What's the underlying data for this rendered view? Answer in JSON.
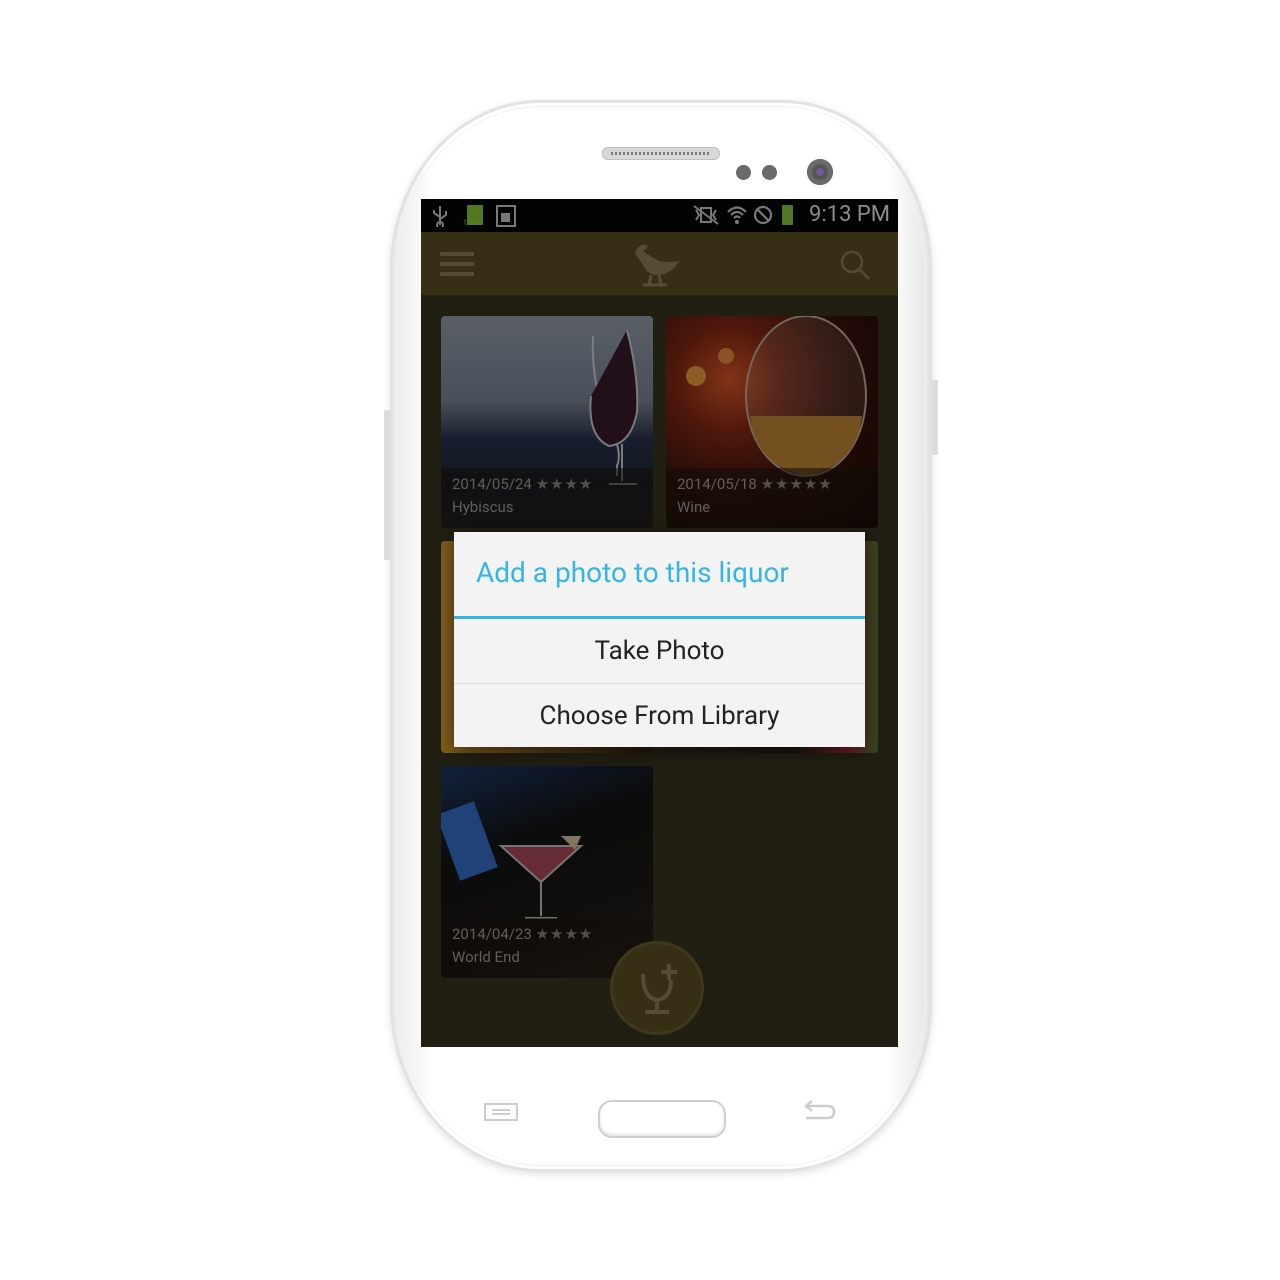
{
  "status_bar": {
    "time": "9:13 PM",
    "battery_label": "100%",
    "icons": [
      "usb-icon",
      "battery-full-icon",
      "sim-card-icon",
      "vibrate-icon",
      "wifi-icon",
      "block-icon",
      "battery-icon"
    ]
  },
  "app_bar": {
    "icons": [
      "menu-icon",
      "bird-logo-icon",
      "search-icon"
    ]
  },
  "cards": [
    {
      "date": "2014/05/24",
      "stars": "★★★★",
      "name": "Hybiscus"
    },
    {
      "date": "2014/05/18",
      "stars": "★★★★★",
      "name": "Wine"
    },
    {
      "date": "2014/04/23",
      "stars": "★★★★",
      "name": "World End"
    }
  ],
  "dialog": {
    "title": "Add a photo to this liquor",
    "options": [
      "Take Photo",
      "Choose From Library"
    ]
  },
  "fab": {
    "icon": "add-glass-icon"
  },
  "colors": {
    "accent": "#33b5e5",
    "app_bar": "#5e5224",
    "dialog_bg": "#f3f3f3"
  }
}
